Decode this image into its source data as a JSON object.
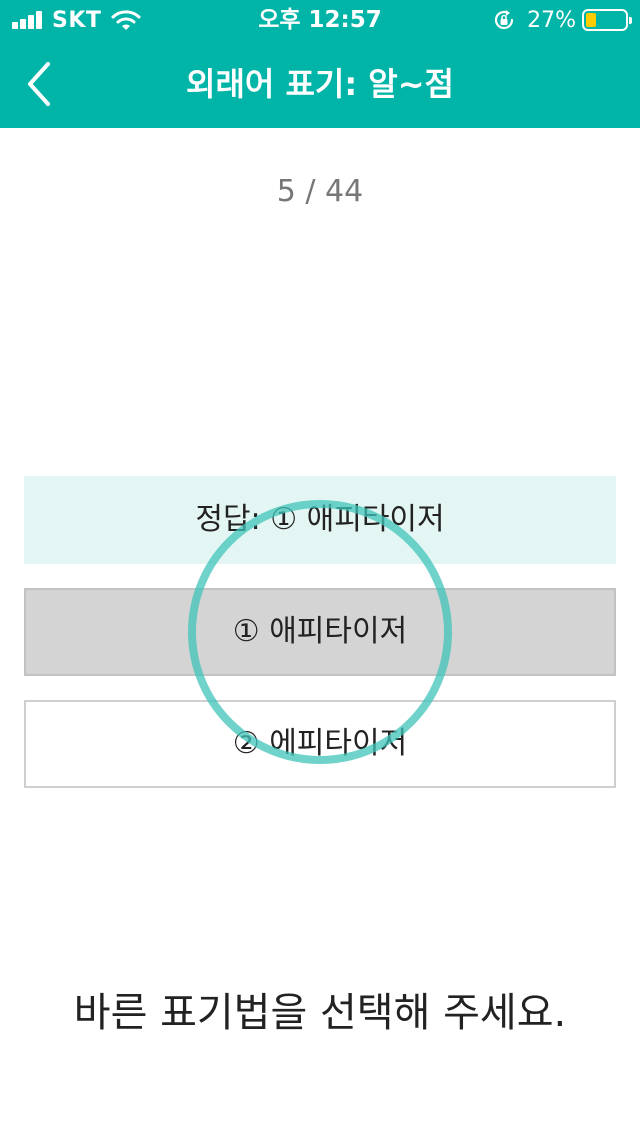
{
  "status_bar": {
    "carrier": "SKT",
    "time": "오후 12:57",
    "battery_percent": "27%",
    "battery_level": 0.27,
    "icons": [
      "signal-bars-icon",
      "wifi-icon",
      "rotation-lock-icon",
      "battery-icon"
    ]
  },
  "nav": {
    "back_icon": "chevron-left-icon",
    "title": "외래어 표기: 알~점"
  },
  "quiz": {
    "counter": "5 / 44",
    "answer": "정답: ① 애피타이저",
    "options": [
      {
        "label": "① 애피타이저",
        "selected": true
      },
      {
        "label": "② 에피타이저",
        "selected": false
      }
    ],
    "prompt": "바른 표기법을 선택해 주세요."
  },
  "colors": {
    "header": "#00b4a7",
    "answer_bg": "#e4f6f4",
    "selected_option_bg": "#d4d4d4",
    "tap_ring": "#40c4ba",
    "battery_fill": "#ffcc00"
  }
}
